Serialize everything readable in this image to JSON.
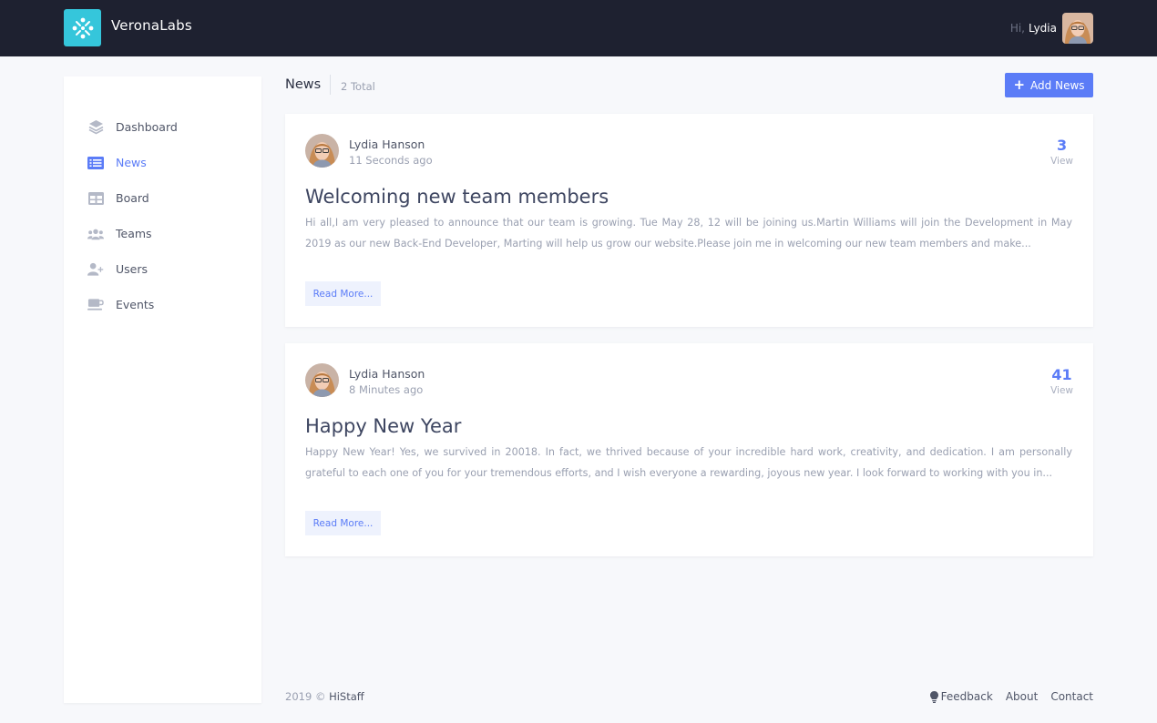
{
  "app": {
    "brand": "VeronaLabs",
    "accent": "#5b7cf7",
    "topbar_color": "#1e2130",
    "logo_color": "#35c6db"
  },
  "user": {
    "greeting": "Hi,",
    "name": "Lydia"
  },
  "sidebar": {
    "items": [
      {
        "label": "Dashboard",
        "icon": "layers-icon"
      },
      {
        "label": "News",
        "icon": "list-icon",
        "active": true
      },
      {
        "label": "Board",
        "icon": "table-icon"
      },
      {
        "label": "Teams",
        "icon": "users-group-icon"
      },
      {
        "label": "Users",
        "icon": "user-plus-icon"
      },
      {
        "label": "Events",
        "icon": "coffee-cup-icon"
      }
    ]
  },
  "header": {
    "title": "News",
    "total": "2 Total",
    "add_label": "Add News"
  },
  "news": [
    {
      "author": "Lydia Hanson",
      "time": "11 Seconds ago",
      "views": "3",
      "views_label": "View",
      "title": "Welcoming new team members",
      "excerpt": "Hi all,I am very pleased to announce that our team is growing. Tue May 28, 12 will be joining us.Martin Williams will join the Development in May 2019 as our new Back-End Developer, Marting will help us grow our website.Please join me in welcoming our new team members and make...",
      "more_label": "Read More..."
    },
    {
      "author": "Lydia Hanson",
      "time": "8 Minutes ago",
      "views": "41",
      "views_label": "View",
      "title": "Happy New Year",
      "excerpt": "Happy New Year! Yes, we survived in 20018. In fact, we thrived because of your incredible hard work, creativity, and dedication. I am personally grateful to each one of you for your tremendous efforts, and I wish everyone a rewarding, joyous new year. I look forward to working with you in...",
      "more_label": "Read More..."
    }
  ],
  "footer": {
    "year": "2019",
    "copyright_symbol": "©",
    "company": "HiStaff",
    "links": [
      {
        "label": "Feedback",
        "icon": "lightbulb-icon"
      },
      {
        "label": "About"
      },
      {
        "label": "Contact"
      }
    ]
  }
}
